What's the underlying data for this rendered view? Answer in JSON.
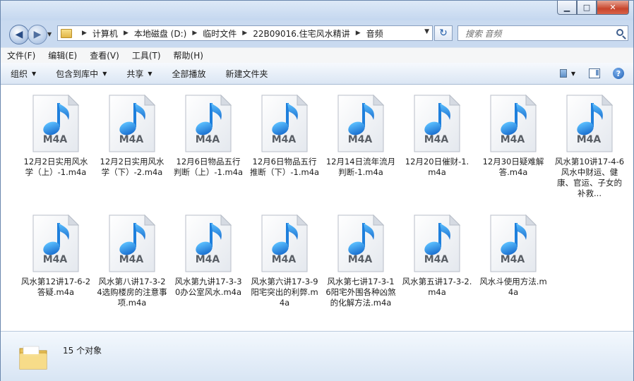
{
  "window": {
    "controls": {
      "minimize": "▁",
      "maximize": "□",
      "close": "✕"
    }
  },
  "nav": {
    "back": "◀",
    "forward": "▶",
    "refresh": "↻"
  },
  "address": {
    "crumbs": [
      "计算机",
      "本地磁盘 (D:)",
      "临时文件",
      "22B09016.住宅风水精讲",
      "音频"
    ]
  },
  "search": {
    "placeholder": "搜索 音频"
  },
  "menubar": [
    "文件(F)",
    "编辑(E)",
    "查看(V)",
    "工具(T)",
    "帮助(H)"
  ],
  "toolbar": {
    "organize": "组织",
    "include_library": "包含到库中",
    "share": "共享",
    "play_all": "全部播放",
    "new_folder": "新建文件夹"
  },
  "file_type_label": "M4A",
  "files": [
    {
      "name": "12月2日实用风水学（上）-1.m4a"
    },
    {
      "name": "12月2日实用风水学（下）-2.m4a"
    },
    {
      "name": "12月6日物品五行判断（上）-1.m4a"
    },
    {
      "name": "12月6日物品五行推断（下）-1.m4a"
    },
    {
      "name": "12月14日流年流月判断-1.m4a"
    },
    {
      "name": "12月20日催财-1.m4a"
    },
    {
      "name": "12月30日疑难解答.m4a"
    },
    {
      "name": "风水第10讲17-4-6风水中财运、健康、官运、子女的补救..."
    },
    {
      "name": "风水第12讲17-6-2答疑.m4a"
    },
    {
      "name": "风水第八讲17-3-24选购楼房的注意事项.m4a"
    },
    {
      "name": "风水第九讲17-3-30办公室风水.m4a"
    },
    {
      "name": "风水第六讲17-3-9阳宅突出的利弊.m4a"
    },
    {
      "name": "风水第七讲17-3-16阳宅外围各种凶煞的化解方法.m4a"
    },
    {
      "name": "风水第五讲17-3-2.m4a"
    },
    {
      "name": "风水斗使用方法.m4a"
    }
  ],
  "status": {
    "count_text": "15 个对象"
  },
  "colors": {
    "note_blue": "#2a8fe0",
    "window_frame": "#c9daf0"
  }
}
